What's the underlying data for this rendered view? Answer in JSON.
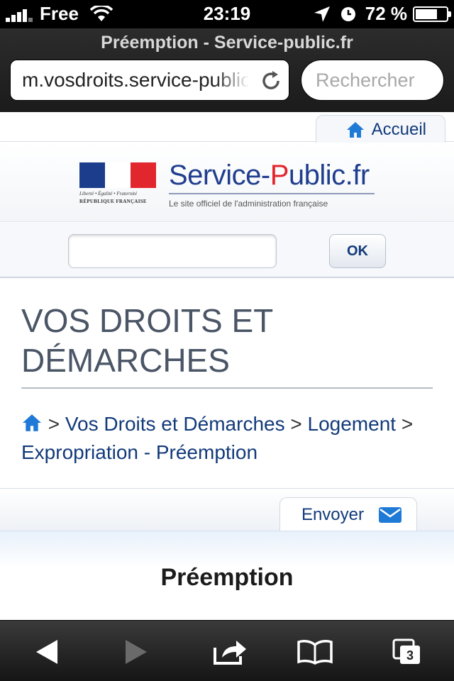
{
  "status_bar": {
    "carrier": "Free",
    "time": "23:19",
    "battery_percent_label": "72 %",
    "battery_level": 0.72
  },
  "browser": {
    "page_title": "Préemption - Service-public.fr",
    "url": "m.vosdroits.service-public.fr",
    "search_placeholder": "Rechercher",
    "tab_count": "3"
  },
  "site": {
    "home_tab_label": "Accueil",
    "rf_motto": "Liberté • Égalité • Fraternité",
    "rf_name": "RÉPUBLIQUE FRANÇAISE",
    "brand_left": "Service-",
    "brand_p": "P",
    "brand_right": "ublic.fr",
    "tagline": "Le site officiel de l'administration française",
    "search_value": "",
    "ok_label": "OK"
  },
  "content": {
    "section_title": "VOS DROITS ET DÉMARCHES",
    "breadcrumb": {
      "sep": ">",
      "items": [
        "Vos Droits et Démarches",
        "Logement",
        "Expropriation - Préemption"
      ]
    },
    "send_label": "Envoyer",
    "article_title": "Préemption"
  },
  "colors": {
    "link": "#123a7a",
    "brand_blue": "#1f3e8e",
    "brand_red": "#e2262d",
    "icon_blue": "#1e7ad6"
  }
}
